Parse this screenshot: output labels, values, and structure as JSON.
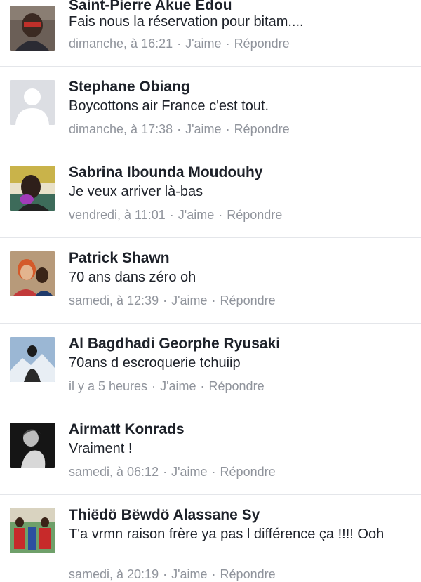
{
  "comments": [
    {
      "name": "Saint-Pierre Akue Edou",
      "text": "Fais nous la réservation pour bitam....",
      "time": "dimanche, à 16:21",
      "like": "J'aime",
      "reply": "Répondre",
      "avatar": "person-photo-icon"
    },
    {
      "name": "Stephane Obiang",
      "text": "Boycottons air France c'est tout.",
      "time": "dimanche, à 17:38",
      "like": "J'aime",
      "reply": "Répondre",
      "avatar": "default-profile-icon"
    },
    {
      "name": "Sabrina Ibounda Moudouhy",
      "text": "Je veux arriver là-bas",
      "time": "vendredi, à 11:01",
      "like": "J'aime",
      "reply": "Répondre",
      "avatar": "person-photo-icon"
    },
    {
      "name": "Patrick Shawn",
      "text": "70 ans dans zéro oh",
      "time": "samedi, à 12:39",
      "like": "J'aime",
      "reply": "Répondre",
      "avatar": "couple-photo-icon"
    },
    {
      "name": "Al Bagdhadi Georphe Ryusaki",
      "text": "70ans d escroquerie tchuiip",
      "time": "il y a 5 heures",
      "like": "J'aime",
      "reply": "Répondre",
      "avatar": "mountain-photo-icon"
    },
    {
      "name": "Airmatt Konrads",
      "text": "Vraiment !",
      "time": "samedi, à 06:12",
      "like": "J'aime",
      "reply": "Répondre",
      "avatar": "bw-portrait-icon"
    },
    {
      "name": "Thiëdö Bëwdö Alassane Sy",
      "text": "T'a vrmn raison frère ya pas l différence ça !!!! Ooh",
      "time": "samedi, à 20:19",
      "like": "J'aime",
      "reply": "Répondre",
      "avatar": "group-photo-icon"
    }
  ],
  "separator": "·"
}
